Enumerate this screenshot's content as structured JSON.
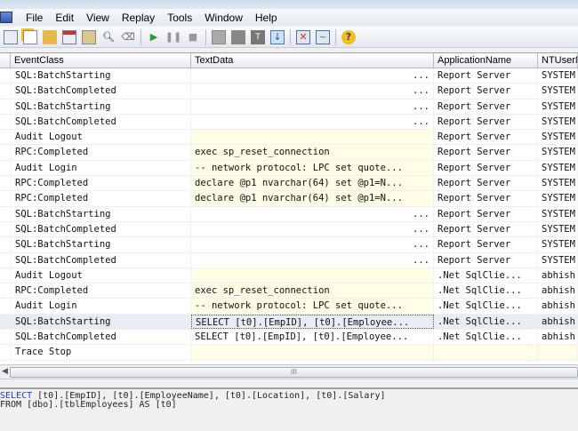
{
  "menu": [
    "File",
    "Edit",
    "View",
    "Replay",
    "Tools",
    "Window",
    "Help"
  ],
  "toolbar_icons": [
    "new-trace-icon",
    "new-file-icon",
    "open-icon",
    "properties-icon",
    "template-icon",
    "find-icon",
    "clear-icon",
    "run-icon",
    "pause-icon",
    "stop-icon",
    "cascade-icon",
    "columns-icon",
    "text-icon",
    "autoscroll-icon",
    "replay-icon",
    "perfmon-icon",
    "help-icon"
  ],
  "columns": [
    "EventClass",
    "TextData",
    "ApplicationName",
    "NTUserName"
  ],
  "rows": [
    {
      "event": "SQL:BatchStarting",
      "text": "...",
      "app": "Report Server",
      "user": "SYSTEM",
      "type": "batch"
    },
    {
      "event": "SQL:BatchCompleted",
      "text": "...",
      "app": "Report Server",
      "user": "SYSTEM",
      "type": "batch"
    },
    {
      "event": "SQL:BatchStarting",
      "text": "...",
      "app": "Report Server",
      "user": "SYSTEM",
      "type": "batch"
    },
    {
      "event": "SQL:BatchCompleted",
      "text": "...",
      "app": "Report Server",
      "user": "SYSTEM",
      "type": "batch"
    },
    {
      "event": "Audit Logout",
      "text": "",
      "app": "Report Server",
      "user": "SYSTEM",
      "type": "other"
    },
    {
      "event": "RPC:Completed",
      "text": "exec sp_reset_connection",
      "app": "Report Server",
      "user": "SYSTEM",
      "type": "other"
    },
    {
      "event": "Audit Login",
      "text": "-- network protocol: LPC  set quote...",
      "app": "Report Server",
      "user": "SYSTEM",
      "type": "other"
    },
    {
      "event": "RPC:Completed",
      "text": "declare @p1 nvarchar(64)  set @p1=N...",
      "app": "Report Server",
      "user": "SYSTEM",
      "type": "other"
    },
    {
      "event": "RPC:Completed",
      "text": "declare @p1 nvarchar(64)  set @p1=N...",
      "app": "Report Server",
      "user": "SYSTEM",
      "type": "other"
    },
    {
      "event": "SQL:BatchStarting",
      "text": "...",
      "app": "Report Server",
      "user": "SYSTEM",
      "type": "batch"
    },
    {
      "event": "SQL:BatchCompleted",
      "text": "...",
      "app": "Report Server",
      "user": "SYSTEM",
      "type": "batch"
    },
    {
      "event": "SQL:BatchStarting",
      "text": "...",
      "app": "Report Server",
      "user": "SYSTEM",
      "type": "batch"
    },
    {
      "event": "SQL:BatchCompleted",
      "text": "...",
      "app": "Report Server",
      "user": "SYSTEM",
      "type": "batch"
    },
    {
      "event": "Audit Logout",
      "text": "",
      "app": ".Net SqlClie...",
      "user": "abhish",
      "type": "other"
    },
    {
      "event": "RPC:Completed",
      "text": "exec sp_reset_connection",
      "app": ".Net SqlClie...",
      "user": "abhish",
      "type": "other"
    },
    {
      "event": "Audit Login",
      "text": "-- network protocol: LPC  set quote...",
      "app": ".Net SqlClie...",
      "user": "abhish",
      "type": "other"
    },
    {
      "event": "SQL:BatchStarting",
      "text": "SELECT [t0].[EmpID], [t0].[Employee...",
      "app": ".Net SqlClie...",
      "user": "abhish",
      "type": "selected"
    },
    {
      "event": "SQL:BatchCompleted",
      "text": "SELECT [t0].[EmpID], [t0].[Employee...",
      "app": ".Net SqlClie...",
      "user": "abhish",
      "type": "plain"
    },
    {
      "event": "Trace Stop",
      "text": "",
      "app": "",
      "user": "",
      "type": "stop"
    }
  ],
  "scrollbar_grip": "III",
  "detail": {
    "line1_kw": "SELECT",
    "line1_rest": " [t0].[EmpID], [t0].[EmployeeName], [t0].[Location], [t0].[Salary]",
    "line2": "FROM [dbo].[tblEmployees] AS [t0]"
  }
}
